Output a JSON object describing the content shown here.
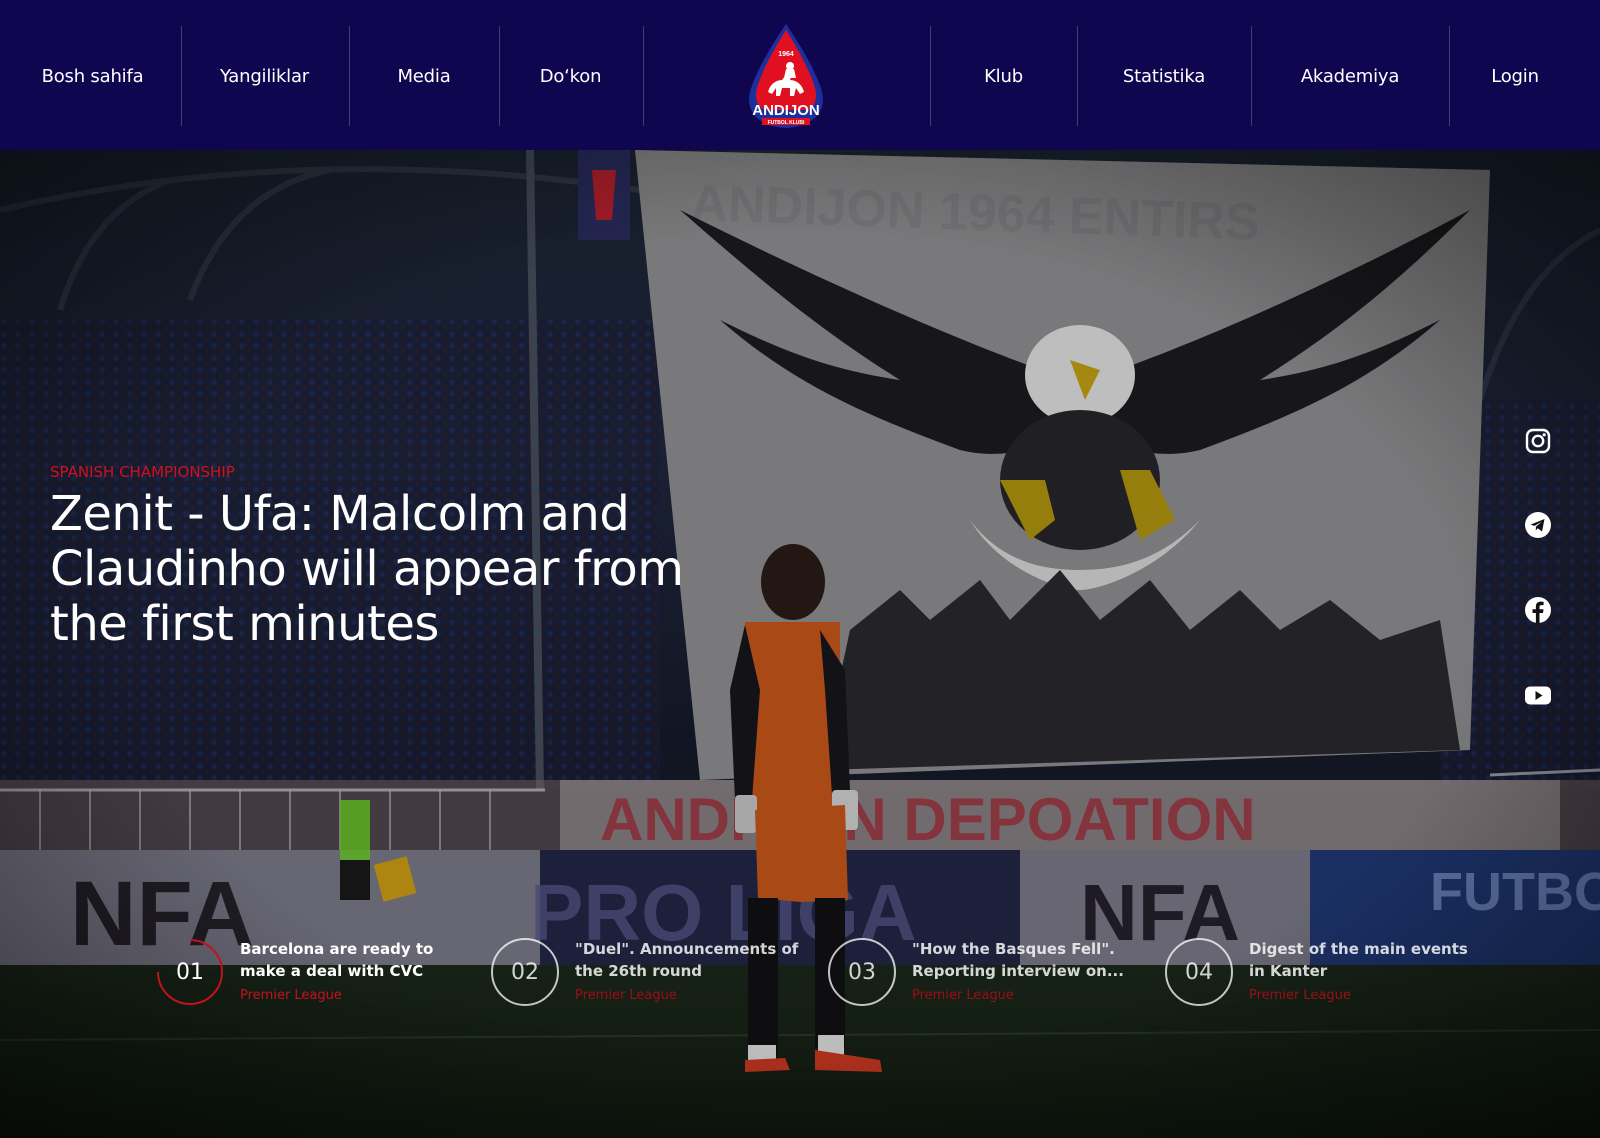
{
  "header": {
    "nav_left": [
      "Bosh sahifa",
      "Yangiliklar",
      "Media",
      "Do‘kon"
    ],
    "nav_right": [
      "Klub",
      "Statistika",
      "Akademiya",
      "Login"
    ],
    "logo": {
      "year": "1964",
      "name": "ANDIJON",
      "subtitle": "FUTBOL KLUBI"
    }
  },
  "hero": {
    "kicker": "SPANISH CHAMPIONSHIP",
    "headline": "Zenit - Ufa: Malcolm and Claudinho will appear from the first minutes"
  },
  "social": [
    "instagram-icon",
    "telegram-icon",
    "facebook-icon",
    "youtube-icon"
  ],
  "news": [
    {
      "num": "01",
      "title_lines": [
        "Barcelona are ready to",
        "make a deal with CVC"
      ],
      "tag": "Premier League",
      "active": true
    },
    {
      "num": "02",
      "title_lines": [
        "\"Duel\". Announcements of",
        "the 26th round"
      ],
      "tag": "Premier League",
      "active": false
    },
    {
      "num": "03",
      "title_lines": [
        "\"How the Basques Fell\".",
        "Reporting interview on..."
      ],
      "tag": "Premier League",
      "active": false
    },
    {
      "num": "04",
      "title_lines": [
        "Digest of the main events",
        "in Kanter"
      ],
      "tag": "Premier League",
      "active": false
    }
  ],
  "colors": {
    "header_bg": "#100650",
    "accent_red": "#d01120",
    "logo_blue": "#1d2f9c"
  }
}
